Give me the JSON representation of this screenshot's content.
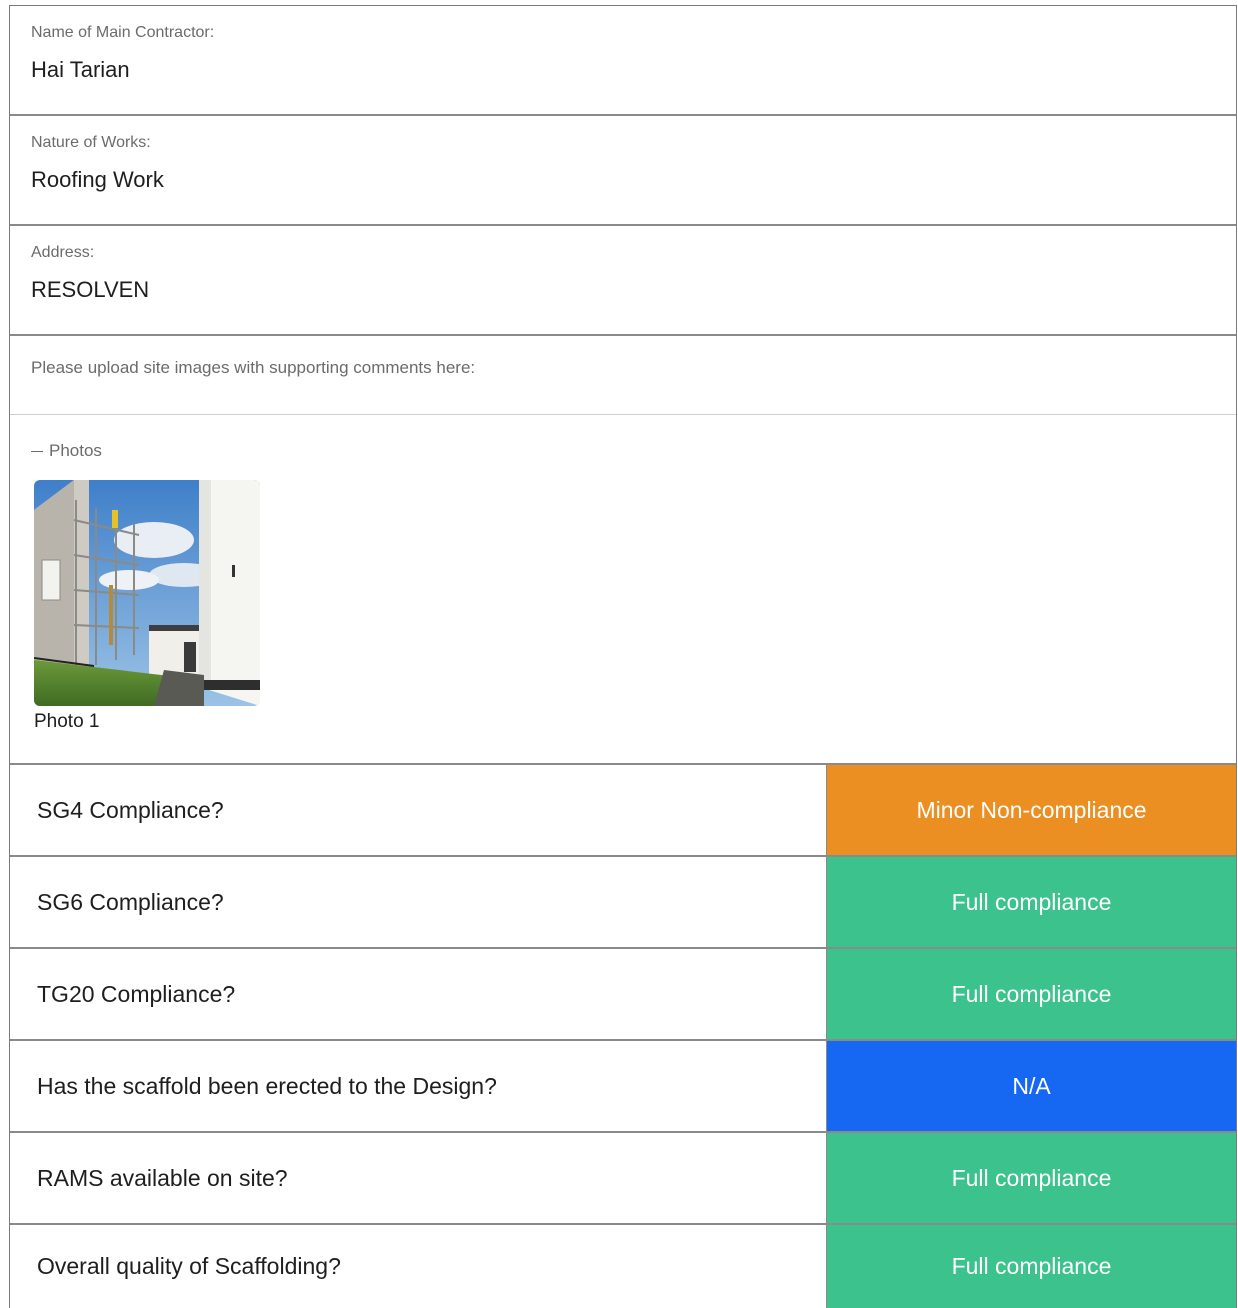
{
  "fields": [
    {
      "label": "Name of Main Contractor:",
      "value": "Hai Tarian"
    },
    {
      "label": "Nature of Works:",
      "value": "Roofing Work"
    },
    {
      "label": "Address:",
      "value": "RESOLVEN"
    }
  ],
  "upload_prompt": "Please upload site images with supporting comments here:",
  "photos": {
    "section_title": "Photos",
    "items": [
      {
        "caption": "Photo 1",
        "icon": "site-photo-scaffold"
      }
    ]
  },
  "compliance": [
    {
      "question": "SG4 Compliance?",
      "answer": "Minor Non-compliance",
      "color": "#ec8f22"
    },
    {
      "question": "SG6 Compliance?",
      "answer": "Full compliance",
      "color": "#3cc28c"
    },
    {
      "question": "TG20 Compliance?",
      "answer": "Full compliance",
      "color": "#3cc28c"
    },
    {
      "question": "Has the scaffold been erected to the Design?",
      "answer": "N/A",
      "color": "#1667f2"
    },
    {
      "question": "RAMS available on site?",
      "answer": "Full compliance",
      "color": "#3cc28c"
    },
    {
      "question": "Overall quality of Scaffolding?",
      "answer": "Full compliance",
      "color": "#3cc28c"
    }
  ]
}
